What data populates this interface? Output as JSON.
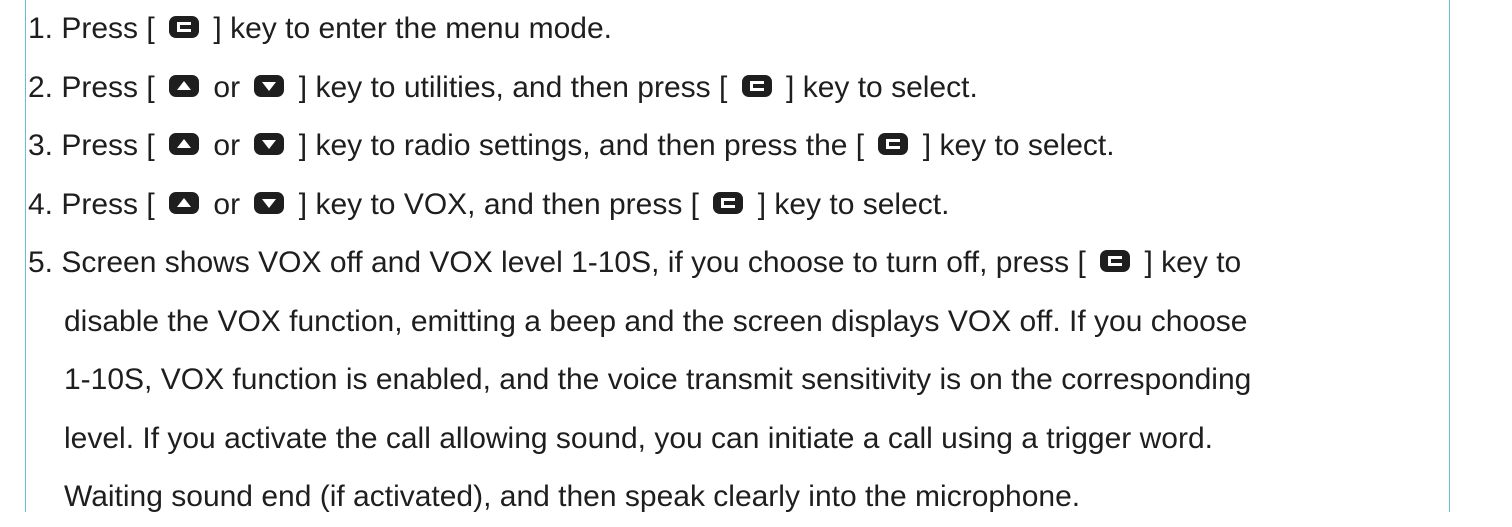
{
  "steps": [
    {
      "num": "1.",
      "t1": " Press [",
      "t2": "] key to enter the menu mode."
    },
    {
      "num": "2.",
      "t1": " Press [",
      "or": " or ",
      "t2": "] key to utilities, and then press [",
      "t3": "] key to select."
    },
    {
      "num": "3.",
      "t1": " Press [",
      "or": " or ",
      "t2": "] key to radio settings, and then press the [",
      "t3": "] key to select."
    },
    {
      "num": "4.",
      "t1": " Press [",
      "or": " or ",
      "t2": "] key to VOX, and then press [",
      "t3": "] key to select."
    },
    {
      "num": "5.",
      "t1": " Screen shows VOX off and VOX level 1-10S, if you choose to turn off, press [",
      "t2": "] key to",
      "cont": [
        "disable the VOX function, emitting a beep and the screen displays VOX off. If you choose",
        "1-10S, VOX function is enabled, and the voice transmit sensitivity is on the corresponding",
        "level. If you activate the call allowing sound, you can initiate a call using a trigger word.",
        "Waiting sound end (if activated), and then speak clearly into the microphone."
      ]
    }
  ],
  "icons": {
    "menu_key": "menu-key-icon",
    "up_key": "up-key-icon",
    "down_key": "down-key-icon"
  }
}
